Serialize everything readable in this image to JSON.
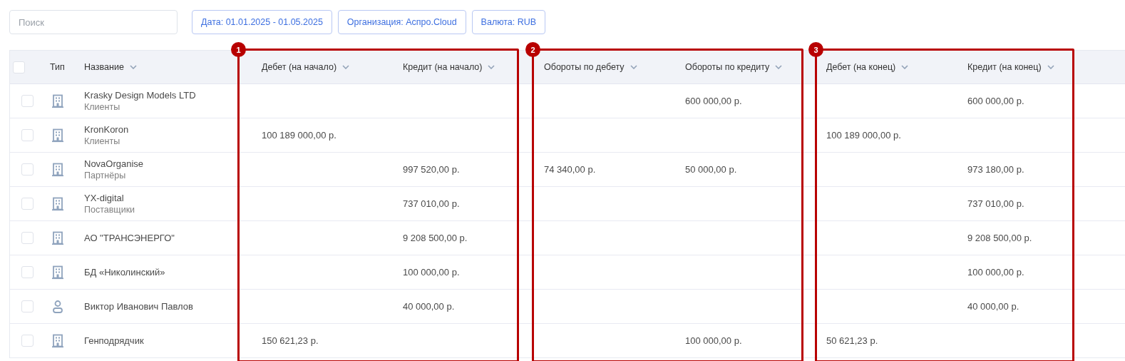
{
  "search": {
    "placeholder": "Поиск"
  },
  "filters": [
    "Дата: 01.01.2025 - 01.05.2025",
    "Организация: Аспро.Cloud",
    "Валюта: RUB"
  ],
  "table": {
    "select_all": {
      "checked": false
    },
    "columns": [
      {
        "label": "Тип",
        "sortable": false
      },
      {
        "label": "Название",
        "sortable": true
      },
      {
        "label": "Дебет (на начало)",
        "sortable": true
      },
      {
        "label": "Кредит (на начало)",
        "sortable": true
      },
      {
        "label": "Обороты по дебету",
        "sortable": true
      },
      {
        "label": "Обороты по кредиту",
        "sortable": true
      },
      {
        "label": "Дебет (на конец)",
        "sortable": true
      },
      {
        "label": "Кредит (на конец)",
        "sortable": true
      }
    ],
    "rows": [
      {
        "checked": false,
        "kind": "organization",
        "name": "Krasky Design Models LTD",
        "group": "Клиенты",
        "credit_turnover": "600 000,00 р.",
        "credit_end": "600 000,00 р."
      },
      {
        "checked": false,
        "kind": "organization",
        "name": "KronKoron",
        "group": "Клиенты",
        "debit_start": "100 189 000,00 р.",
        "debit_end": "100 189 000,00 р."
      },
      {
        "checked": false,
        "kind": "organization",
        "name": "NovaOrganise",
        "group": "Партнёры",
        "credit_start": "997 520,00 р.",
        "debit_turnover": "74 340,00 р.",
        "credit_turnover": "50 000,00 р.",
        "credit_end": "973 180,00 р."
      },
      {
        "checked": false,
        "kind": "organization",
        "name": "YX-digital",
        "group": "Поставщики",
        "credit_start": "737 010,00 р.",
        "credit_end": "737 010,00 р."
      },
      {
        "checked": false,
        "kind": "organization",
        "name": "АО \"ТРАНСЭНЕРГО\"",
        "credit_start": "9 208 500,00 р.",
        "credit_end": "9 208 500,00 р."
      },
      {
        "checked": false,
        "kind": "organization",
        "name": "БД «Николинский»",
        "credit_start": "100 000,00 р.",
        "credit_end": "100 000,00 р."
      },
      {
        "checked": false,
        "kind": "person",
        "name": "Виктор Иванович Павлов",
        "credit_start": "40 000,00 р.",
        "credit_end": "40 000,00 р."
      },
      {
        "checked": false,
        "kind": "organization",
        "name": "Генподрядчик",
        "debit_start": "150 621,23 р.",
        "credit_turnover": "100 000,00 р.",
        "debit_end": "50 621,23 р."
      }
    ]
  },
  "highlights": [
    {
      "label": "1"
    },
    {
      "label": "2"
    },
    {
      "label": "3"
    }
  ]
}
